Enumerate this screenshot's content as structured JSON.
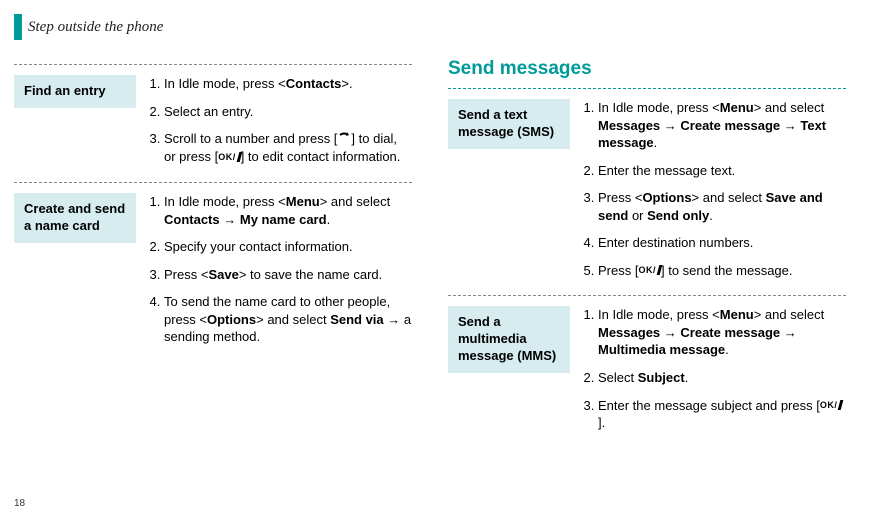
{
  "page_number": "18",
  "header_title": "Step outside the phone",
  "left": {
    "block1": {
      "label": "Find an entry",
      "steps": [
        {
          "pre": "In Idle mode, press <",
          "b1": "Contacts",
          "post": ">."
        },
        {
          "text": "Select an entry."
        },
        {
          "pre": "Scroll to a number and press [",
          "icon1": "dial",
          "mid": "] to dial, or press [",
          "icon2": "ok",
          "post": "] to edit contact information."
        }
      ]
    },
    "block2": {
      "label": "Create and send a name card",
      "steps": [
        {
          "pre": "In Idle mode, press <",
          "b1": "Menu",
          "mid": "> and select ",
          "b2": "Contacts",
          "arrow": " → ",
          "b3": "My name card",
          "post": "."
        },
        {
          "text": "Specify your contact information."
        },
        {
          "pre": "Press <",
          "b1": "Save",
          "post": "> to save the name card."
        },
        {
          "pre": "To send the name card to other people, press <",
          "b1": "Options",
          "mid": "> and select ",
          "b2": "Send via",
          "arrow": " → ",
          "post2": "a sending method."
        }
      ]
    }
  },
  "right": {
    "section_title": "Send messages",
    "block1": {
      "label": "Send a text message (SMS)",
      "steps": [
        {
          "pre": "In Idle mode, press <",
          "b1": "Menu",
          "mid": "> and select ",
          "b2": "Messages",
          "arrow": " → ",
          "b3": "Create message",
          "arrow2": " → ",
          "b4": "Text message",
          "post": "."
        },
        {
          "text": "Enter the message text."
        },
        {
          "pre": "Press <",
          "b1": "Options",
          "mid": "> and select ",
          "b2": "Save and send",
          "or": " or ",
          "b3": "Send only",
          "post": "."
        },
        {
          "text": "Enter destination numbers."
        },
        {
          "pre": "Press [",
          "icon1": "ok",
          "post": "] to send the message."
        }
      ]
    },
    "block2": {
      "label": "Send a multimedia message (MMS)",
      "steps": [
        {
          "pre": "In Idle mode, press <",
          "b1": "Menu",
          "mid": "> and select ",
          "b2": "Messages",
          "arrow": " → ",
          "b3": "Create message",
          "arrow2": " → ",
          "b4": "Multimedia message",
          "post": "."
        },
        {
          "pre": "Select ",
          "b1": "Subject",
          "post": "."
        },
        {
          "pre": "Enter the message subject and press [",
          "icon1": "ok",
          "post": "]."
        }
      ]
    }
  }
}
